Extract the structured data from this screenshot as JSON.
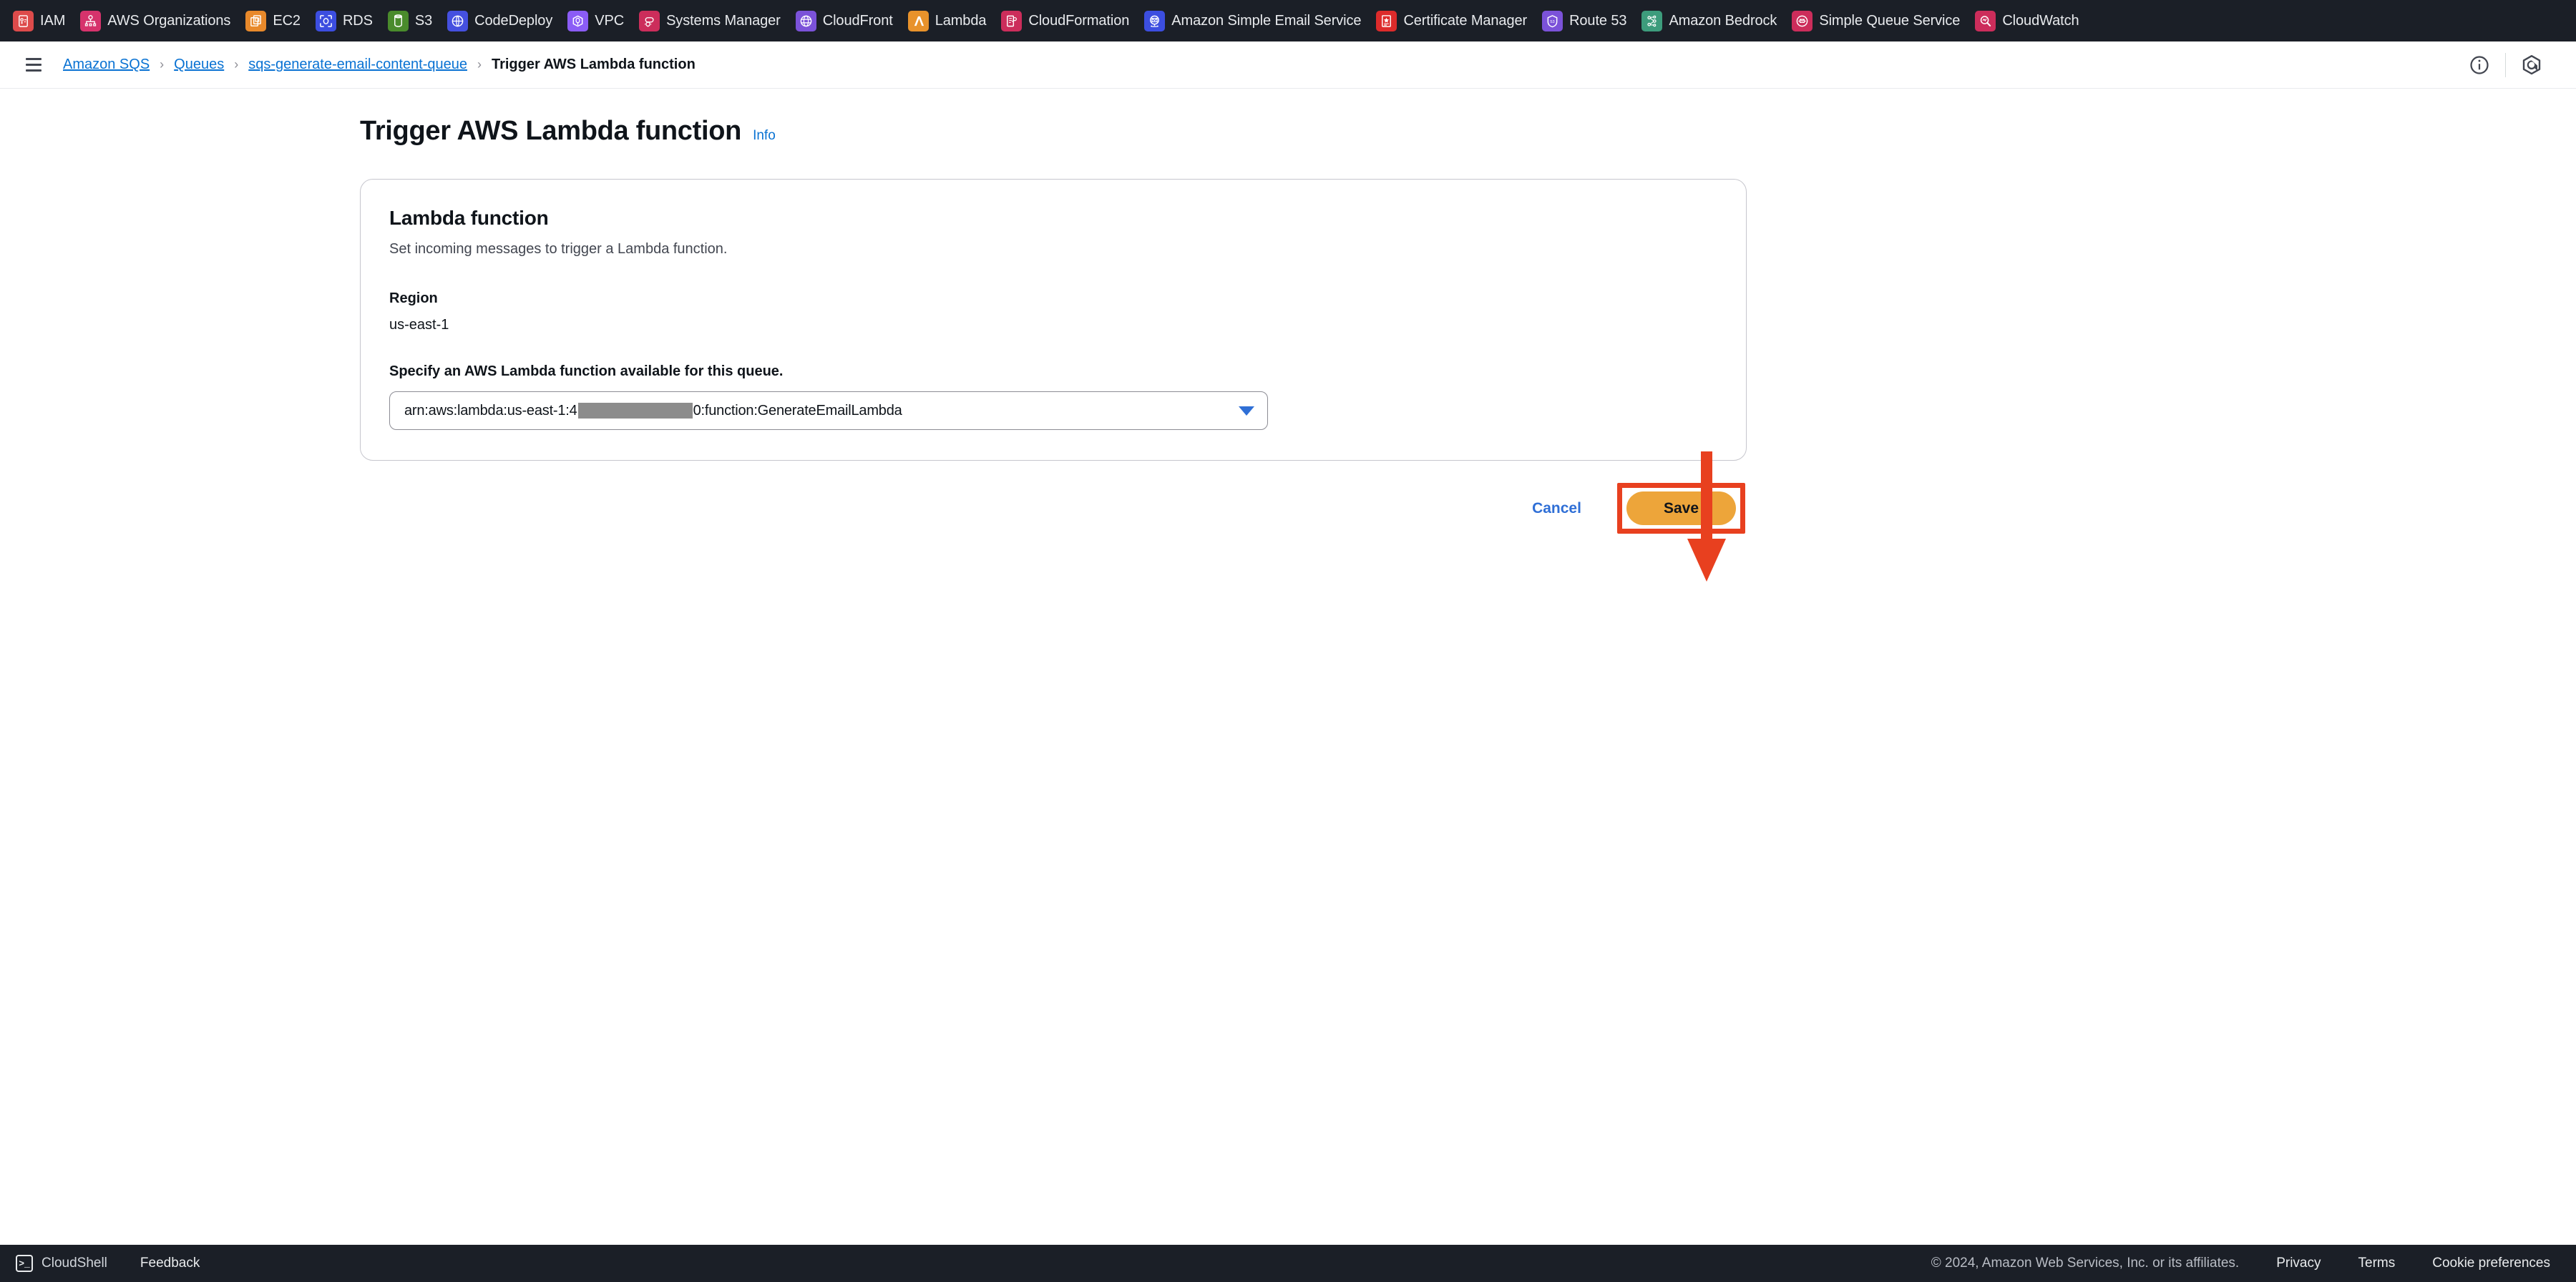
{
  "bookmarks": [
    {
      "label": "IAM",
      "icon": "iam-icon",
      "color": "#dd4b4b"
    },
    {
      "label": "AWS Organizations",
      "icon": "organizations-icon",
      "color": "#d6336c"
    },
    {
      "label": "EC2",
      "icon": "ec2-icon",
      "color": "#e8892b"
    },
    {
      "label": "RDS",
      "icon": "rds-icon",
      "color": "#3c4ee0"
    },
    {
      "label": "S3",
      "icon": "s3-icon",
      "color": "#4a8b2c"
    },
    {
      "label": "CodeDeploy",
      "icon": "codedeploy-icon",
      "color": "#4550e0"
    },
    {
      "label": "VPC",
      "icon": "vpc-icon",
      "color": "#8b5cf6"
    },
    {
      "label": "Systems Manager",
      "icon": "systems-manager-icon",
      "color": "#cc2d5b"
    },
    {
      "label": "CloudFront",
      "icon": "cloudfront-icon",
      "color": "#7b52d9"
    },
    {
      "label": "Lambda",
      "icon": "lambda-icon",
      "color": "#e8922b"
    },
    {
      "label": "CloudFormation",
      "icon": "cloudformation-icon",
      "color": "#cc2d5b"
    },
    {
      "label": "Amazon Simple Email Service",
      "icon": "ses-icon",
      "color": "#3c4ee0"
    },
    {
      "label": "Certificate Manager",
      "icon": "certificate-manager-icon",
      "color": "#dd2b2b"
    },
    {
      "label": "Route 53",
      "icon": "route53-icon",
      "color": "#7b52d9"
    },
    {
      "label": "Amazon Bedrock",
      "icon": "bedrock-icon",
      "color": "#3d9c7c"
    },
    {
      "label": "Simple Queue Service",
      "icon": "sqs-icon",
      "color": "#cc2d5b"
    },
    {
      "label": "CloudWatch",
      "icon": "cloudwatch-icon",
      "color": "#cc2d5b"
    }
  ],
  "topnav": {
    "menu_icon": "hamburger-menu-icon",
    "breadcrumb": [
      {
        "label": "Amazon SQS",
        "current": false
      },
      {
        "label": "Queues",
        "current": false
      },
      {
        "label": "sqs-generate-email-content-queue",
        "current": false
      },
      {
        "label": "Trigger AWS Lambda function",
        "current": true
      }
    ],
    "separator": "›",
    "info_icon": "info-circle-icon",
    "assistant_icon": "amazon-q-icon"
  },
  "page": {
    "title": "Trigger AWS Lambda function",
    "info_label": "Info"
  },
  "card": {
    "title": "Lambda function",
    "description": "Set incoming messages to trigger a Lambda function.",
    "region_label": "Region",
    "region_value": "us-east-1",
    "select_label": "Specify an AWS Lambda function available for this queue.",
    "select_value_prefix": "arn:aws:lambda:us-east-1:4",
    "select_value_redacted": "██████████",
    "select_value_suffix": "0:function:GenerateEmailLambda",
    "caret_icon": "chevron-down-icon"
  },
  "actions": {
    "cancel_label": "Cancel",
    "save_label": "Save"
  },
  "annotation": {
    "arrow_color": "#e8401f",
    "highlight_color": "#e8401f",
    "arrow_icon": "down-arrow-annotation"
  },
  "footer": {
    "cloudshell_label": "CloudShell",
    "cloudshell_icon": "cloudshell-terminal-icon",
    "feedback_label": "Feedback",
    "copyright": "© 2024, Amazon Web Services, Inc. or its affiliates.",
    "links": [
      "Privacy",
      "Terms",
      "Cookie preferences"
    ]
  },
  "colors": {
    "accent_link": "#0972d3",
    "save_button": "#eda53a",
    "dark_bar": "#1b1f27",
    "annotation_red": "#e8401f"
  }
}
